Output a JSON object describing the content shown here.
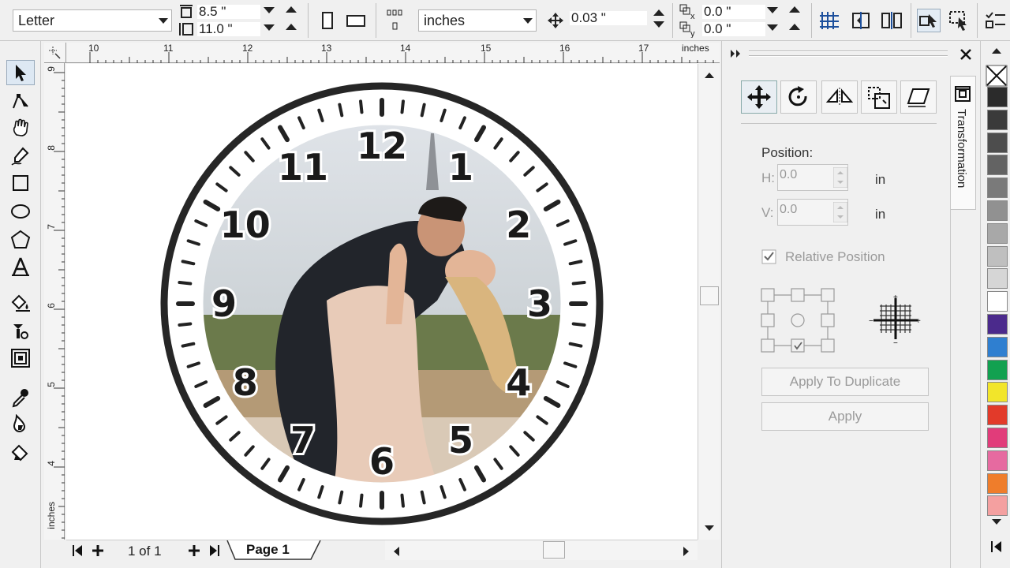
{
  "propbar": {
    "paper_size": "Letter",
    "width": "8.5 \"",
    "height": "11.0 \"",
    "units": "inches",
    "nudge": "0.03 \"",
    "dup_x": "0.0 \"",
    "dup_y": "0.0 \""
  },
  "ruler": {
    "h_labels": [
      "10",
      "11",
      "12",
      "13",
      "14",
      "15",
      "16",
      "17"
    ],
    "h_units": "inches",
    "v_labels": [
      "9",
      "8",
      "7",
      "6",
      "5",
      "4"
    ],
    "v_units": "inches"
  },
  "clock": {
    "numerals": [
      "12",
      "1",
      "2",
      "3",
      "4",
      "5",
      "6",
      "7",
      "8",
      "9",
      "10",
      "11"
    ]
  },
  "pagebar": {
    "page_count": "1 of 1",
    "page_tab": "Page 1"
  },
  "docker": {
    "title": "Transformation",
    "position_label": "Position:",
    "h_label": "H:",
    "h_value": "0.0",
    "v_label": "V:",
    "v_value": "0.0",
    "unit": "in",
    "relative_position": "Relative Position",
    "relative_checked": true,
    "apply_duplicate": "Apply To Duplicate",
    "apply": "Apply"
  },
  "palette": {
    "colors": [
      "#2b2b2b",
      "#3a3a3a",
      "#4d4d4d",
      "#636363",
      "#7a7a7a",
      "#919191",
      "#a8a8a8",
      "#bfbfbf",
      "#d6d6d6",
      "#ffffff",
      "#4b2a8c",
      "#2f7fd0",
      "#12a150",
      "#f2e52a",
      "#e23a2a",
      "#e13c7a",
      "#e66aa0",
      "#ef7d2b",
      "#f4a0a0"
    ]
  }
}
